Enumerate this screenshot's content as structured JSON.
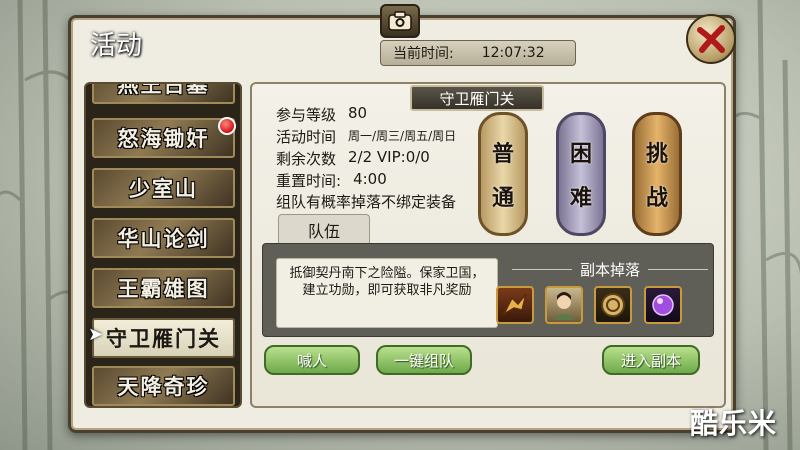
{
  "window": {
    "title": "活动"
  },
  "clock": {
    "label": "当前时间:",
    "value": "12:07:32"
  },
  "tabs": [
    {
      "label": "燕王古墓",
      "active": false
    },
    {
      "label": "怒海锄奸",
      "active": false,
      "badge": "red-dot"
    },
    {
      "label": "少室山",
      "active": false
    },
    {
      "label": "华山论剑",
      "active": false
    },
    {
      "label": "王霸雄图",
      "active": false
    },
    {
      "label": "守卫雁门关",
      "active": true
    },
    {
      "label": "天降奇珍",
      "active": false
    }
  ],
  "activity": {
    "name": "守卫雁门关",
    "level_label": "参与等级",
    "level_value": "80",
    "time_label": "活动时间",
    "time_value": "周一/周三/周五/周日",
    "count_label": "剩余次数",
    "count_value": "2/2 VIP:0/0",
    "reset_label": "重置时间:",
    "reset_value": "4:00",
    "note": "组队有概率掉落不绑定装备"
  },
  "difficulty": {
    "normal": [
      "普",
      "通"
    ],
    "hard": [
      "困",
      "难"
    ],
    "challenge": [
      "挑",
      "战"
    ]
  },
  "team": {
    "tab_label": "队伍",
    "description": "抵御契丹南下之险隘。保家卫国，建立功勋，即可获取非凡奖励",
    "drop_title": "副本掉落",
    "drops": [
      "dragon-item-icon",
      "hero-portrait-icon",
      "rune-coin-icon",
      "purple-gem-icon"
    ]
  },
  "buttons": {
    "shout": "喊人",
    "quick_team": "一键组队",
    "enter": "进入副本"
  },
  "watermark": "酷乐米",
  "colors": {
    "accent_green": "#6fa94a",
    "badge_red": "#d3101a",
    "frame": "#4a4032"
  }
}
